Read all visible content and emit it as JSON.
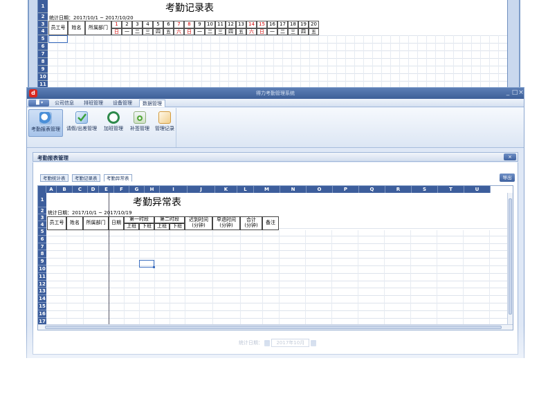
{
  "background_sheet": {
    "title": "考勤记录表",
    "period": "统计日期：2017/10/1 ~ 2017/10/20",
    "row_numbers": [
      "1",
      "2",
      "3",
      "4",
      "5",
      "6",
      "7",
      "8",
      "9",
      "10",
      "11"
    ],
    "fixed_headers": [
      "员工号",
      "姓名",
      "所属部门"
    ],
    "days": [
      "1",
      "2",
      "3",
      "4",
      "5",
      "6",
      "7",
      "8",
      "9",
      "10",
      "11",
      "12",
      "13",
      "14",
      "15",
      "16",
      "17",
      "18",
      "19",
      "20"
    ],
    "weekdays": [
      "日",
      "一",
      "二",
      "三",
      "四",
      "五",
      "六",
      "日",
      "一",
      "二",
      "三",
      "四",
      "五",
      "六",
      "日",
      "一",
      "二",
      "三",
      "四",
      "五"
    ],
    "weekend_day_indexes": [
      0,
      6,
      7,
      13,
      14
    ]
  },
  "window": {
    "title": "得力考勤管理系统",
    "min_label": "_",
    "max_label": "□",
    "close_label": "×"
  },
  "menu": {
    "app_button": "▐▌▾",
    "tabs": [
      "公司信息",
      "排班管理",
      "设备管理",
      "数据管理"
    ],
    "active_tab": "数据管理"
  },
  "ribbon": {
    "buttons": [
      {
        "label": "考勤报表管理",
        "icon": "report-magnifier-icon",
        "color": "#4a8fd8",
        "active": true
      },
      {
        "label": "请假/出差管理",
        "icon": "leave-check-icon",
        "color": "#58b24a",
        "active": false
      },
      {
        "label": "加班管理",
        "icon": "overtime-clock-icon",
        "color": "#3b9c5a",
        "active": false
      },
      {
        "label": "补签管理",
        "icon": "resign-doc-icon",
        "color": "#6ab04c",
        "active": false
      },
      {
        "label": "管理记录",
        "icon": "record-note-icon",
        "color": "#e2a24a",
        "active": false
      }
    ]
  },
  "panel": {
    "title": "考勤报表管理",
    "close_label": "×",
    "tabs": [
      "考勤统计表",
      "考勤记录表",
      "考勤异常表"
    ],
    "active_tab": "考勤异常表",
    "export_label": "导出"
  },
  "sheet": {
    "columns": [
      "A",
      "B",
      "C",
      "D",
      "E",
      "F",
      "G",
      "H",
      "I",
      "J",
      "K",
      "L",
      "M",
      "N",
      "O",
      "P",
      "Q",
      "R",
      "S",
      "T",
      "U"
    ],
    "rows": [
      "1",
      "2",
      "3",
      "4",
      "5",
      "6",
      "7",
      "8",
      "9",
      "10",
      "11",
      "12",
      "13",
      "14",
      "15",
      "16",
      "17"
    ],
    "title": "考勤异常表",
    "period": "统计日期：2017/10/1 ~ 2017/10/19",
    "headers": {
      "emp_id": "员工号",
      "name": "姓名",
      "dept": "所属部门",
      "date": "日期",
      "period1": "第一时段",
      "period2": "第二时段",
      "on_duty": "上班",
      "off_duty": "下班",
      "late": "迟到时间\n(分钟)",
      "early": "早退时间\n(分钟)",
      "total": "合计\n(分钟)",
      "remark": "备注"
    }
  },
  "date_filter": {
    "label": "统计日期：",
    "value": "2017年10月"
  }
}
